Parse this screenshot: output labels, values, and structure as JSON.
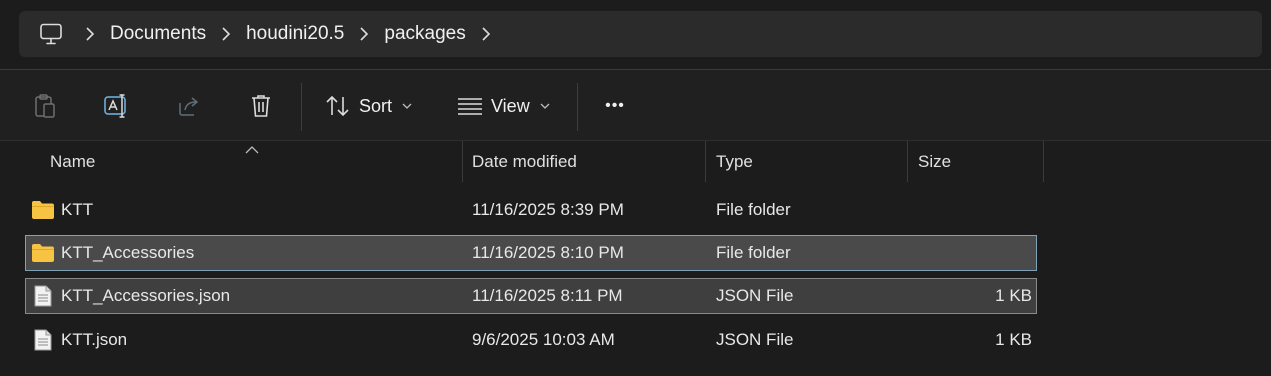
{
  "address": {
    "crumbs": [
      "Documents",
      "houdini20.5",
      "packages"
    ],
    "root_icon": "computer-icon"
  },
  "toolbar": {
    "icons": [
      "paste-icon",
      "rename-icon",
      "share-icon",
      "delete-icon"
    ],
    "sort_label": "Sort",
    "view_label": "View",
    "more_label": "•••"
  },
  "columns": {
    "name": "Name",
    "date": "Date modified",
    "type": "Type",
    "size": "Size"
  },
  "files": [
    {
      "name": "KTT",
      "date": "11/16/2025 8:39 PM",
      "type": "File folder",
      "size": "",
      "icon": "folder-icon",
      "state": "normal"
    },
    {
      "name": "KTT_Accessories",
      "date": "11/16/2025 8:10 PM",
      "type": "File folder",
      "size": "",
      "icon": "folder-icon",
      "state": "selected-focused"
    },
    {
      "name": "KTT_Accessories.json",
      "date": "11/16/2025 8:11 PM",
      "type": "JSON File",
      "size": "1 KB",
      "icon": "file-icon",
      "state": "selected"
    },
    {
      "name": "KTT.json",
      "date": "9/6/2025 10:03 AM",
      "type": "JSON File",
      "size": "1 KB",
      "icon": "file-icon",
      "state": "normal"
    }
  ],
  "colors": {
    "folder": "#f6c343",
    "selection_border": "#7ea3b8",
    "background": "#1c1c1c"
  }
}
